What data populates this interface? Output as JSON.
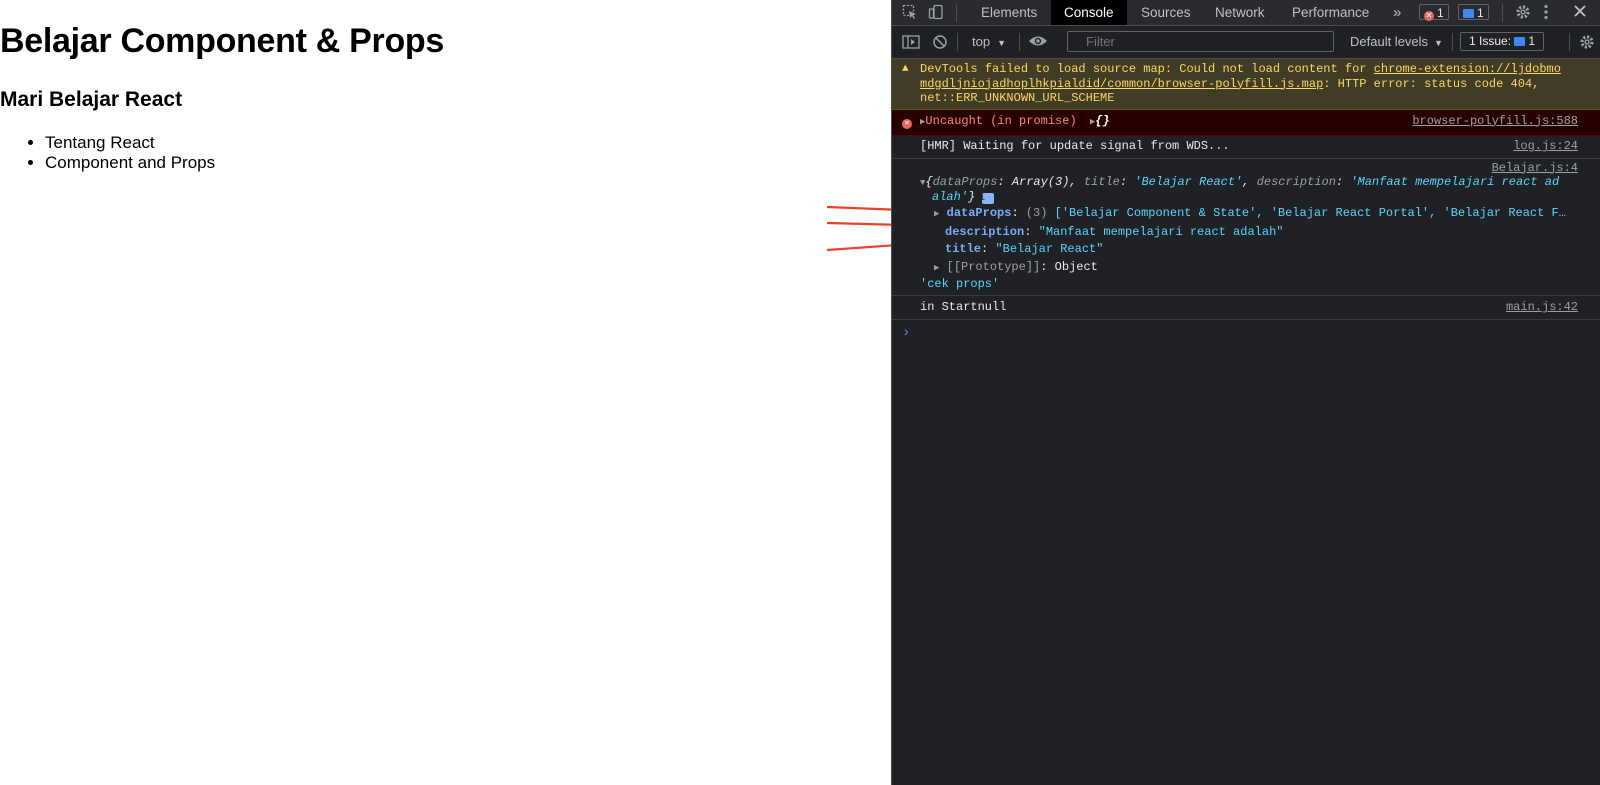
{
  "page": {
    "title": "Belajar Component & Props",
    "subtitle": "Mari Belajar React",
    "items": [
      "Tentang React",
      "Component and Props"
    ]
  },
  "devtools": {
    "tabs": [
      "Elements",
      "Console",
      "Sources",
      "Network",
      "Performance"
    ],
    "more": "»",
    "error_count": "1",
    "message_count": "1",
    "toolbar": {
      "context": "top",
      "filter_placeholder": "Filter",
      "levels": "Default levels",
      "issues_label": "1 Issue:",
      "issues_count": "1"
    },
    "log": {
      "warn_part1": "DevTools failed to load source map: Could not load content for ",
      "warn_link1": "chrome-extension://ljdobmo",
      "warn_link2": "mdgdljniojadhoplhkpialdid/common/browser-polyfill.js.map",
      "warn_part2": ": HTTP error: status code 404,",
      "warn_part3": "net::ERR_UNKNOWN_URL_SCHEME",
      "err_text": "Uncaught (in promise)",
      "err_obj": "{}",
      "err_src": "browser-polyfill.js:588",
      "hmr_text": "[HMR] Waiting for update signal from WDS...",
      "hmr_src": "log.js:24",
      "obj_src": "Belajar.js:4",
      "obj_k1": "dataProps",
      "obj_v1": "Array(3)",
      "obj_k2": "title",
      "obj_v2": "'Belajar React'",
      "obj_k3": "description",
      "obj_v3a": "'Manfaat mempelajari react ad",
      "obj_v3b": "alah'",
      "prop1_key": "dataProps",
      "prop1_count": "(3)",
      "prop1_val": "['Belajar Component & State', 'Belajar React Portal', 'Belajar React F…",
      "prop2_key": "description",
      "prop2_val": "\"Manfaat mempelajari react adalah\"",
      "prop3_key": "title",
      "prop3_val": "\"Belajar React\"",
      "proto_key": "[[Prototype]]",
      "proto_val": "Object",
      "cek_props": "'cek props'",
      "start_text": "in Startnull",
      "start_src": "main.js:42"
    },
    "prompt": "›"
  },
  "colors": {
    "annotation_arrow": "#e8412c",
    "devtools_bg": "#202124"
  }
}
